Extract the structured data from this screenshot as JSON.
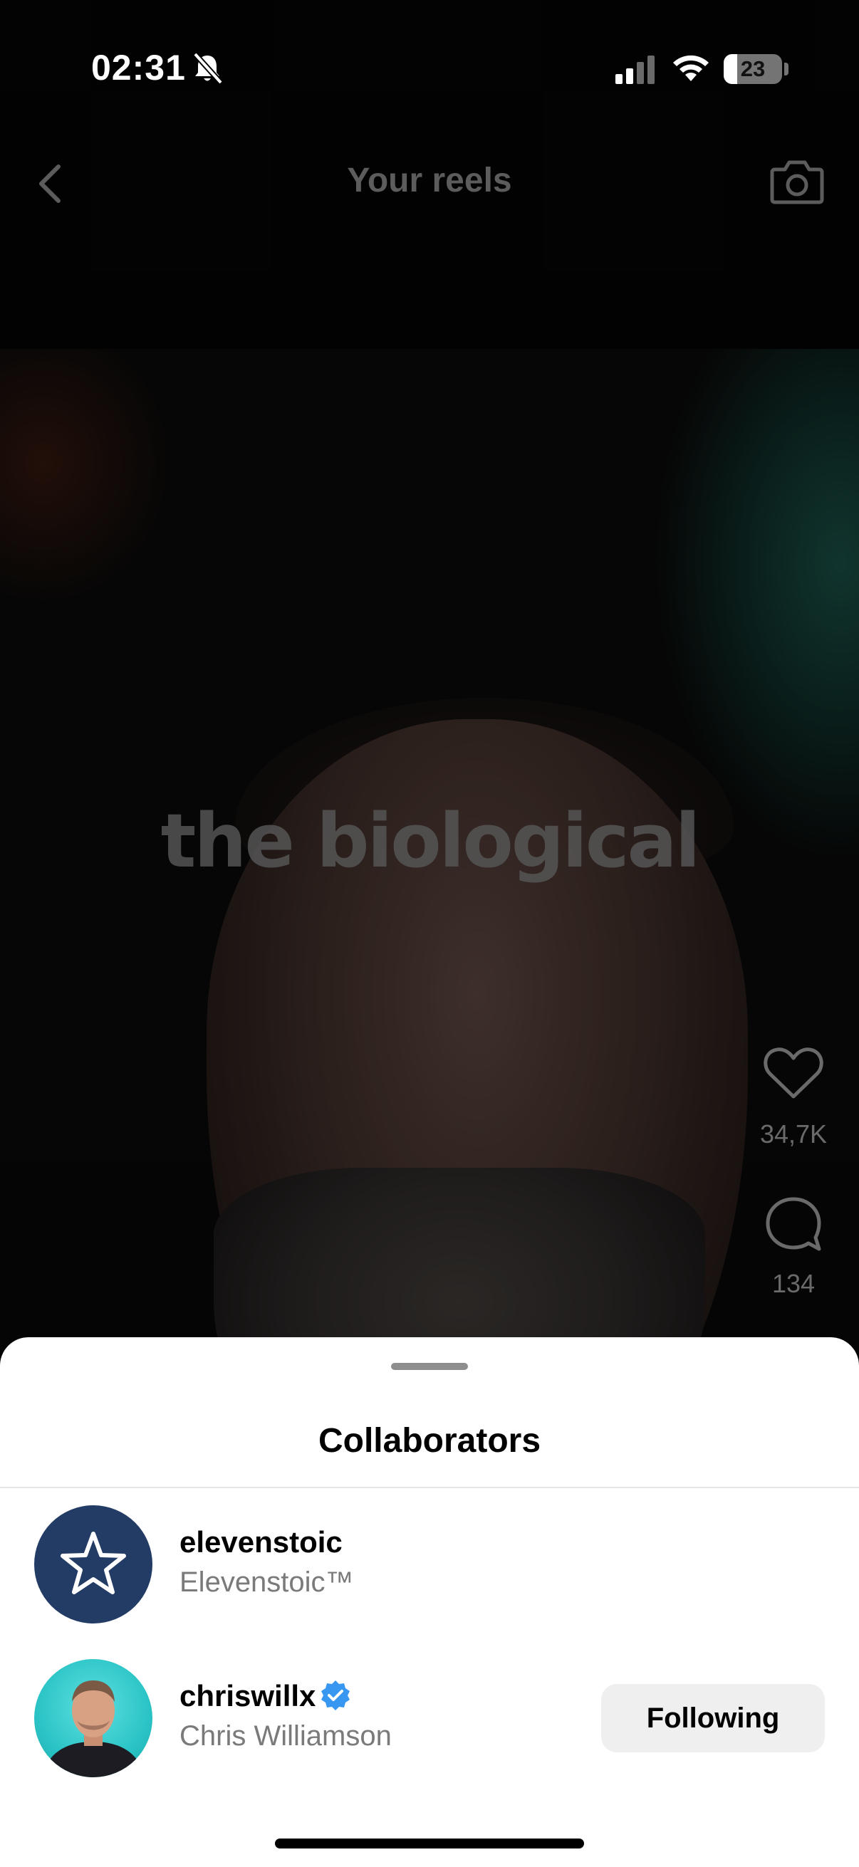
{
  "status_bar": {
    "time": "02:31",
    "battery_level": "23"
  },
  "header": {
    "title": "Your reels"
  },
  "video": {
    "caption": "the biological"
  },
  "actions": {
    "like_count": "34,7K",
    "comment_count": "134"
  },
  "sheet": {
    "title": "Collaborators",
    "collaborators": [
      {
        "username": "elevenstoic",
        "full_name": "Elevenstoic™",
        "avatar": "star-logo",
        "verified": false
      },
      {
        "username": "chriswillx",
        "full_name": "Chris Williamson",
        "avatar": "profile-photo",
        "verified": true,
        "follow_label": "Following"
      }
    ]
  },
  "colors": {
    "verified_badge": "#3897f0",
    "stoic_avatar_bg": "#233c66",
    "chris_avatar_bg": "#2bc4c6"
  }
}
